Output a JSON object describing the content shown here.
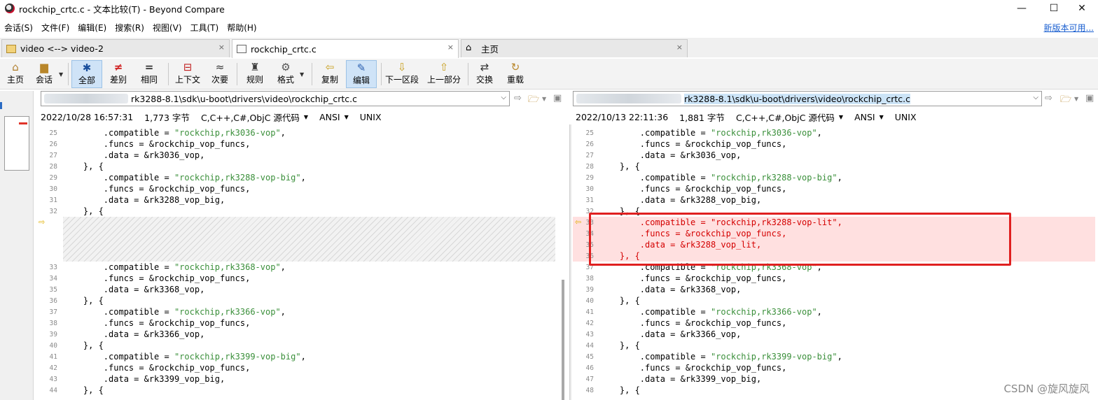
{
  "window": {
    "title": "rockchip_crtc.c - 文本比较(T) - Beyond Compare",
    "minimize_glyph": "—",
    "maximize_glyph": "☐",
    "close_glyph": "✕"
  },
  "menu": {
    "items": [
      "会话(S)",
      "文件(F)",
      "编辑(E)",
      "搜索(R)",
      "视图(V)",
      "工具(T)",
      "帮助(H)"
    ],
    "new_version": "新版本可用..."
  },
  "tabs": [
    {
      "label": "video <--> video-2",
      "icon": "folder-compare-icon",
      "close": "×"
    },
    {
      "label": "rockchip_crtc.c",
      "icon": "text-compare-icon",
      "close": "×"
    },
    {
      "label": "主页",
      "icon": "home-icon",
      "close": "×"
    }
  ],
  "toolbar": {
    "home": "主页",
    "session": "会话",
    "all": "全部",
    "diff": "差别",
    "same": "相同",
    "context": "上下文",
    "minor": "次要",
    "rules": "规则",
    "format": "格式",
    "copy": "复制",
    "edit": "编辑",
    "next_section": "下一区段",
    "prev_section": "上一部分",
    "swap": "交换",
    "reload": "重载"
  },
  "left": {
    "path": "rk3288-8.1\\sdk\\u-boot\\drivers\\video\\rockchip_crtc.c",
    "date": "2022/10/28 16:57:31",
    "size": "1,773 字节",
    "format": "C,C++,C#,ObjC 源代码",
    "encoding": "ANSI",
    "line_ending": "UNIX"
  },
  "right": {
    "path": "rk3288-8.1\\sdk\\u-boot\\drivers\\video\\rockchip_crtc.c",
    "date": "2022/10/13 22:11:36",
    "size": "1,881 字节",
    "format": "C,C++,C#,ObjC 源代码",
    "encoding": "ANSI",
    "line_ending": "UNIX"
  },
  "left_lines": [
    {
      "n": "25",
      "pre": "        .compatible = ",
      "str": "\"rockchip,rk3036-vop\"",
      "post": ","
    },
    {
      "n": "26",
      "pre": "        .funcs = &rockchip_vop_funcs,",
      "str": "",
      "post": ""
    },
    {
      "n": "27",
      "pre": "        .data = &rk3036_vop,",
      "str": "",
      "post": ""
    },
    {
      "n": "28",
      "pre": "    }, {",
      "str": "",
      "post": ""
    },
    {
      "n": "29",
      "pre": "        .compatible = ",
      "str": "\"rockchip,rk3288-vop-big\"",
      "post": ","
    },
    {
      "n": "30",
      "pre": "        .funcs = &rockchip_vop_funcs,",
      "str": "",
      "post": ""
    },
    {
      "n": "31",
      "pre": "        .data = &rk3288_vop_big,",
      "str": "",
      "post": ""
    },
    {
      "n": "32",
      "pre": "    }, {",
      "str": "",
      "post": ""
    },
    {
      "n": "33",
      "pre": "        .compatible = ",
      "str": "\"rockchip,rk3368-vop\"",
      "post": ","
    },
    {
      "n": "34",
      "pre": "        .funcs = &rockchip_vop_funcs,",
      "str": "",
      "post": ""
    },
    {
      "n": "35",
      "pre": "        .data = &rk3368_vop,",
      "str": "",
      "post": ""
    },
    {
      "n": "36",
      "pre": "    }, {",
      "str": "",
      "post": ""
    },
    {
      "n": "37",
      "pre": "        .compatible = ",
      "str": "\"rockchip,rk3366-vop\"",
      "post": ","
    },
    {
      "n": "38",
      "pre": "        .funcs = &rockchip_vop_funcs,",
      "str": "",
      "post": ""
    },
    {
      "n": "39",
      "pre": "        .data = &rk3366_vop,",
      "str": "",
      "post": ""
    },
    {
      "n": "40",
      "pre": "    }, {",
      "str": "",
      "post": ""
    },
    {
      "n": "41",
      "pre": "        .compatible = ",
      "str": "\"rockchip,rk3399-vop-big\"",
      "post": ","
    },
    {
      "n": "42",
      "pre": "        .funcs = &rockchip_vop_funcs,",
      "str": "",
      "post": ""
    },
    {
      "n": "43",
      "pre": "        .data = &rk3399_vop_big,",
      "str": "",
      "post": ""
    },
    {
      "n": "44",
      "pre": "    }, {",
      "str": "",
      "post": ""
    }
  ],
  "right_lines": [
    {
      "n": "25",
      "pre": "        .compatible = ",
      "str": "\"rockchip,rk3036-vop\"",
      "post": ","
    },
    {
      "n": "26",
      "pre": "        .funcs = &rockchip_vop_funcs,",
      "str": "",
      "post": ""
    },
    {
      "n": "27",
      "pre": "        .data = &rk3036_vop,",
      "str": "",
      "post": ""
    },
    {
      "n": "28",
      "pre": "    }, {",
      "str": "",
      "post": ""
    },
    {
      "n": "29",
      "pre": "        .compatible = ",
      "str": "\"rockchip,rk3288-vop-big\"",
      "post": ","
    },
    {
      "n": "30",
      "pre": "        .funcs = &rockchip_vop_funcs,",
      "str": "",
      "post": ""
    },
    {
      "n": "31",
      "pre": "        .data = &rk3288_vop_big,",
      "str": "",
      "post": ""
    },
    {
      "n": "32",
      "pre": "    }, {",
      "str": "",
      "post": ""
    },
    {
      "n": "33",
      "pre": "        .compatible = ",
      "str": "\"rockchip,rk3288-vop-lit\"",
      "post": ","
    },
    {
      "n": "34",
      "pre": "        .funcs = &rockchip_vop_funcs,",
      "str": "",
      "post": ""
    },
    {
      "n": "35",
      "pre": "        .data = &rk3288_vop_lit,",
      "str": "",
      "post": ""
    },
    {
      "n": "36",
      "pre": "    }, {",
      "str": "",
      "post": ""
    },
    {
      "n": "37",
      "pre": "        .compatible = ",
      "str": "\"rockchip,rk3368-vop\"",
      "post": ","
    },
    {
      "n": "38",
      "pre": "        .funcs = &rockchip_vop_funcs,",
      "str": "",
      "post": ""
    },
    {
      "n": "39",
      "pre": "        .data = &rk3368_vop,",
      "str": "",
      "post": ""
    },
    {
      "n": "40",
      "pre": "    }, {",
      "str": "",
      "post": ""
    },
    {
      "n": "41",
      "pre": "        .compatible = ",
      "str": "\"rockchip,rk3366-vop\"",
      "post": ","
    },
    {
      "n": "42",
      "pre": "        .funcs = &rockchip_vop_funcs,",
      "str": "",
      "post": ""
    },
    {
      "n": "43",
      "pre": "        .data = &rk3366_vop,",
      "str": "",
      "post": ""
    },
    {
      "n": "44",
      "pre": "    }, {",
      "str": "",
      "post": ""
    },
    {
      "n": "45",
      "pre": "        .compatible = ",
      "str": "\"rockchip,rk3399-vop-big\"",
      "post": ","
    },
    {
      "n": "46",
      "pre": "        .funcs = &rockchip_vop_funcs,",
      "str": "",
      "post": ""
    },
    {
      "n": "47",
      "pre": "        .data = &rk3399_vop_big,",
      "str": "",
      "post": ""
    },
    {
      "n": "48",
      "pre": "    }, {",
      "str": "",
      "post": ""
    }
  ],
  "colors": {
    "diff_bg": "#ffe0e0",
    "diff_text": "#d40000",
    "string": "#3a8f3a",
    "highlight_box": "#e02020"
  },
  "watermark": "CSDN @旋风旋风"
}
